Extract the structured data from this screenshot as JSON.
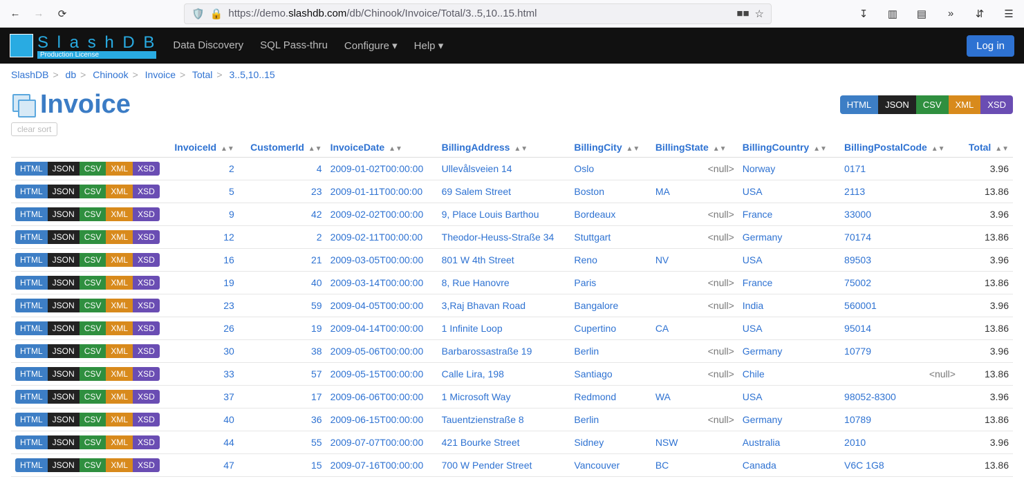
{
  "browser": {
    "url_prefix": "https://demo.",
    "url_domain": "slashdb.com",
    "url_path": "/db/Chinook/Invoice/Total/3..5,10..15.html"
  },
  "navbar": {
    "logo_text": "S l a s h D B",
    "logo_sub": "Production License",
    "links": [
      "Data Discovery",
      "SQL Pass-thru",
      "Configure",
      "Help"
    ],
    "login": "Log in"
  },
  "breadcrumb": [
    "SlashDB",
    "db",
    "Chinook",
    "Invoice",
    "Total",
    "3..5,10..15"
  ],
  "page": {
    "title": "Invoice"
  },
  "formats": {
    "html": "HTML",
    "json": "JSON",
    "csv": "CSV",
    "xml": "XML",
    "xsd": "XSD"
  },
  "clear_sort": "clear sort",
  "null_text": "<null>",
  "columns": [
    "InvoiceId",
    "CustomerId",
    "InvoiceDate",
    "BillingAddress",
    "BillingCity",
    "BillingState",
    "BillingCountry",
    "BillingPostalCode",
    "Total"
  ],
  "rows": [
    {
      "InvoiceId": "2",
      "CustomerId": "4",
      "InvoiceDate": "2009-01-02T00:00:00",
      "BillingAddress": "Ullevålsveien 14",
      "BillingCity": "Oslo",
      "BillingState": null,
      "BillingCountry": "Norway",
      "BillingPostalCode": "0171",
      "Total": "3.96"
    },
    {
      "InvoiceId": "5",
      "CustomerId": "23",
      "InvoiceDate": "2009-01-11T00:00:00",
      "BillingAddress": "69 Salem Street",
      "BillingCity": "Boston",
      "BillingState": "MA",
      "BillingCountry": "USA",
      "BillingPostalCode": "2113",
      "Total": "13.86"
    },
    {
      "InvoiceId": "9",
      "CustomerId": "42",
      "InvoiceDate": "2009-02-02T00:00:00",
      "BillingAddress": "9, Place Louis Barthou",
      "BillingCity": "Bordeaux",
      "BillingState": null,
      "BillingCountry": "France",
      "BillingPostalCode": "33000",
      "Total": "3.96"
    },
    {
      "InvoiceId": "12",
      "CustomerId": "2",
      "InvoiceDate": "2009-02-11T00:00:00",
      "BillingAddress": "Theodor-Heuss-Straße 34",
      "BillingCity": "Stuttgart",
      "BillingState": null,
      "BillingCountry": "Germany",
      "BillingPostalCode": "70174",
      "Total": "13.86"
    },
    {
      "InvoiceId": "16",
      "CustomerId": "21",
      "InvoiceDate": "2009-03-05T00:00:00",
      "BillingAddress": "801 W 4th Street",
      "BillingCity": "Reno",
      "BillingState": "NV",
      "BillingCountry": "USA",
      "BillingPostalCode": "89503",
      "Total": "3.96"
    },
    {
      "InvoiceId": "19",
      "CustomerId": "40",
      "InvoiceDate": "2009-03-14T00:00:00",
      "BillingAddress": "8, Rue Hanovre",
      "BillingCity": "Paris",
      "BillingState": null,
      "BillingCountry": "France",
      "BillingPostalCode": "75002",
      "Total": "13.86"
    },
    {
      "InvoiceId": "23",
      "CustomerId": "59",
      "InvoiceDate": "2009-04-05T00:00:00",
      "BillingAddress": "3,Raj Bhavan Road",
      "BillingCity": "Bangalore",
      "BillingState": null,
      "BillingCountry": "India",
      "BillingPostalCode": "560001",
      "Total": "3.96"
    },
    {
      "InvoiceId": "26",
      "CustomerId": "19",
      "InvoiceDate": "2009-04-14T00:00:00",
      "BillingAddress": "1 Infinite Loop",
      "BillingCity": "Cupertino",
      "BillingState": "CA",
      "BillingCountry": "USA",
      "BillingPostalCode": "95014",
      "Total": "13.86"
    },
    {
      "InvoiceId": "30",
      "CustomerId": "38",
      "InvoiceDate": "2009-05-06T00:00:00",
      "BillingAddress": "Barbarossastraße 19",
      "BillingCity": "Berlin",
      "BillingState": null,
      "BillingCountry": "Germany",
      "BillingPostalCode": "10779",
      "Total": "3.96"
    },
    {
      "InvoiceId": "33",
      "CustomerId": "57",
      "InvoiceDate": "2009-05-15T00:00:00",
      "BillingAddress": "Calle Lira, 198",
      "BillingCity": "Santiago",
      "BillingState": null,
      "BillingCountry": "Chile",
      "BillingPostalCode": null,
      "Total": "13.86"
    },
    {
      "InvoiceId": "37",
      "CustomerId": "17",
      "InvoiceDate": "2009-06-06T00:00:00",
      "BillingAddress": "1 Microsoft Way",
      "BillingCity": "Redmond",
      "BillingState": "WA",
      "BillingCountry": "USA",
      "BillingPostalCode": "98052-8300",
      "Total": "3.96"
    },
    {
      "InvoiceId": "40",
      "CustomerId": "36",
      "InvoiceDate": "2009-06-15T00:00:00",
      "BillingAddress": "Tauentzienstraße 8",
      "BillingCity": "Berlin",
      "BillingState": null,
      "BillingCountry": "Germany",
      "BillingPostalCode": "10789",
      "Total": "13.86"
    },
    {
      "InvoiceId": "44",
      "CustomerId": "55",
      "InvoiceDate": "2009-07-07T00:00:00",
      "BillingAddress": "421 Bourke Street",
      "BillingCity": "Sidney",
      "BillingState": "NSW",
      "BillingCountry": "Australia",
      "BillingPostalCode": "2010",
      "Total": "3.96"
    },
    {
      "InvoiceId": "47",
      "CustomerId": "15",
      "InvoiceDate": "2009-07-16T00:00:00",
      "BillingAddress": "700 W Pender Street",
      "BillingCity": "Vancouver",
      "BillingState": "BC",
      "BillingCountry": "Canada",
      "BillingPostalCode": "V6C 1G8",
      "Total": "13.86"
    }
  ]
}
